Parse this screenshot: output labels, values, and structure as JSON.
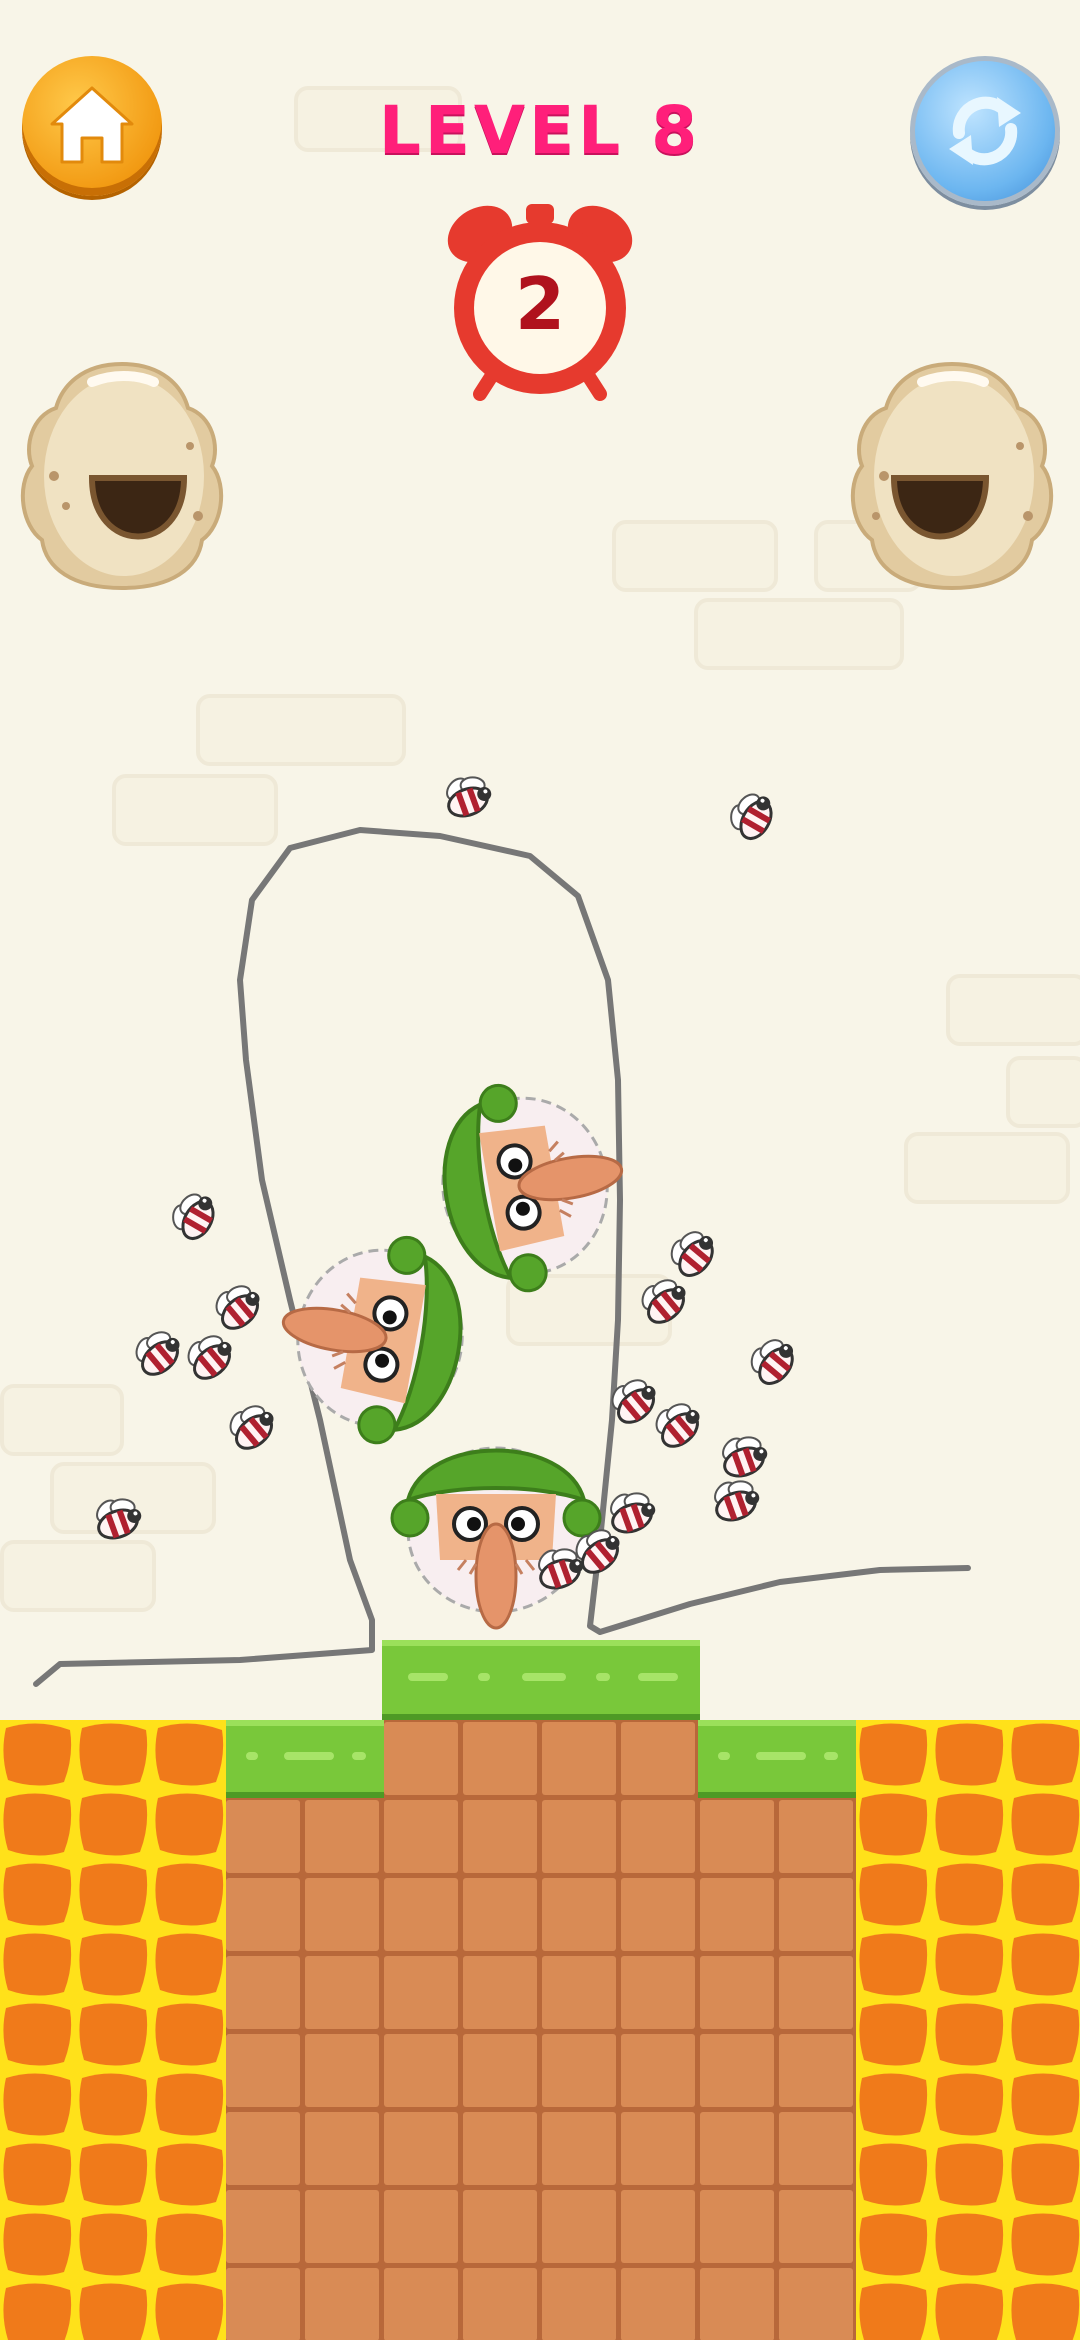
{
  "header": {
    "level_label": "LEVEL 8",
    "timer_value": "2"
  },
  "buttons": {
    "home_icon": "home-icon",
    "restart_icon": "refresh-icon"
  },
  "colors": {
    "level_text": "#ff1f7a",
    "timer_red": "#e63a2e",
    "grass": "#79c83a",
    "dirt": "#d98b55",
    "lava_orange": "#f07a1a",
    "lava_yellow": "#ffe11a",
    "drawn_line": "#777777",
    "background": "#f8f5e8"
  },
  "scene": {
    "characters": [
      "old-man-head",
      "old-man-head",
      "old-man-head"
    ],
    "hives": [
      "beehive",
      "beehive"
    ],
    "bee_count": 18
  }
}
